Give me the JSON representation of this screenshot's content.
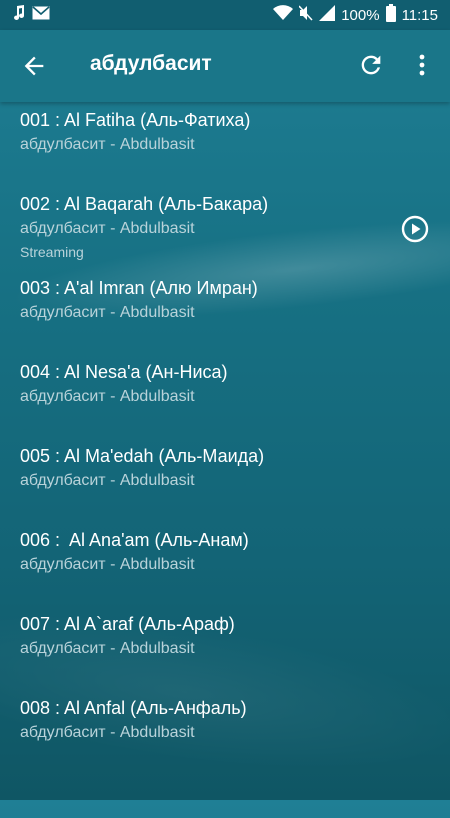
{
  "status_bar": {
    "battery_percent": "100%",
    "time": "11:15",
    "icons": [
      "music-note-icon",
      "mail-icon",
      "wifi-icon",
      "mute-icon",
      "signal-icon",
      "battery-icon"
    ]
  },
  "app_bar": {
    "title": "абдулбасит",
    "icons": [
      "back-arrow-icon",
      "refresh-icon",
      "more-vert-icon"
    ]
  },
  "tracks": [
    {
      "title": "001 : Al Fatiha (Аль-Фатиха)",
      "subtitle": "абдулбасит - Abdulbasit",
      "status": ""
    },
    {
      "title": "002 : Al Baqarah (Аль-Бакара)",
      "subtitle": "абдулбасит - Abdulbasit",
      "status": "Streaming",
      "playing": true
    },
    {
      "title": "003 : A'al Imran (Алю Имран)",
      "subtitle": "абдулбасит - Abdulbasit",
      "status": ""
    },
    {
      "title": "004 : Al Nesa'a (Ан-Ниса)",
      "subtitle": "абдулбасит - Abdulbasit",
      "status": ""
    },
    {
      "title": "005 : Al Ma'edah (Аль-Маида)",
      "subtitle": "абдулбасит - Abdulbasit",
      "status": ""
    },
    {
      "title": "006 :  Al Ana'am (Аль-Анам)",
      "subtitle": "абдулбасит - Abdulbasit",
      "status": ""
    },
    {
      "title": "007 : Al A`araf (Аль-Араф)",
      "subtitle": "абдулбасит - Abdulbasit",
      "status": ""
    },
    {
      "title": "008 : Al Anfal (Аль-Анфаль)",
      "subtitle": "абдулбасит - Abdulbasit",
      "status": ""
    }
  ],
  "colors": {
    "app_bar": "#1a7689",
    "status_bar": "#115e70",
    "subtitle_text": "#b9d3da"
  }
}
